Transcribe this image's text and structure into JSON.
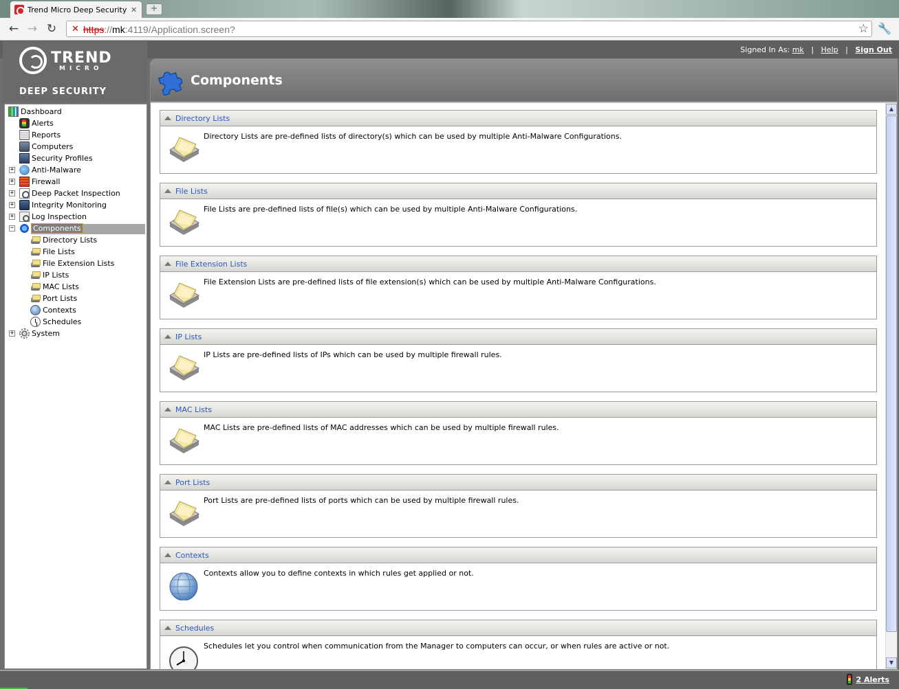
{
  "browser": {
    "tab_title": "Trend Micro Deep Security Ma",
    "url_scheme": "https",
    "url_host": "mk",
    "url_rest": ":4119/Application.screen?"
  },
  "header": {
    "signed_in_label": "Signed In As:",
    "username": "mk",
    "help": "Help",
    "sign_out": "Sign Out",
    "separator": "|"
  },
  "brand": {
    "name": "TREND",
    "sub": "MICRO",
    "product": "DEEP SECURITY"
  },
  "nav": {
    "items": [
      {
        "label": "Dashboard",
        "icon": "dashboard-icon"
      },
      {
        "label": "Alerts",
        "icon": "alerts-icon"
      },
      {
        "label": "Reports",
        "icon": "reports-icon"
      },
      {
        "label": "Computers",
        "icon": "computers-icon"
      },
      {
        "label": "Security Profiles",
        "icon": "security-profiles-icon"
      },
      {
        "label": "Anti-Malware",
        "icon": "anti-malware-icon"
      },
      {
        "label": "Firewall",
        "icon": "firewall-icon"
      },
      {
        "label": "Deep Packet Inspection",
        "icon": "dpi-icon"
      },
      {
        "label": "Integrity Monitoring",
        "icon": "integrity-monitoring-icon"
      },
      {
        "label": "Log Inspection",
        "icon": "log-inspection-icon"
      },
      {
        "label": "Components",
        "icon": "components-icon"
      },
      {
        "label": "Directory Lists",
        "icon": "list-icon"
      },
      {
        "label": "File Lists",
        "icon": "list-icon"
      },
      {
        "label": "File Extension Lists",
        "icon": "list-icon"
      },
      {
        "label": "IP Lists",
        "icon": "list-icon"
      },
      {
        "label": "MAC Lists",
        "icon": "list-icon"
      },
      {
        "label": "Port Lists",
        "icon": "list-icon"
      },
      {
        "label": "Contexts",
        "icon": "contexts-icon"
      },
      {
        "label": "Schedules",
        "icon": "schedules-icon"
      },
      {
        "label": "System",
        "icon": "system-icon"
      }
    ],
    "selected": "Components"
  },
  "main": {
    "title": "Components",
    "sections": [
      {
        "title": "Directory Lists",
        "desc": "Directory Lists are pre-defined lists of directory(s) which can be used by multiple Anti-Malware Configurations.",
        "icon": "list-icon"
      },
      {
        "title": "File Lists",
        "desc": "File Lists are pre-defined lists of file(s) which can be used by multiple Anti-Malware Configurations.",
        "icon": "list-icon"
      },
      {
        "title": "File Extension Lists",
        "desc": "File Extension Lists are pre-defined lists of file extension(s) which can be used by multiple Anti-Malware Configurations.",
        "icon": "list-icon"
      },
      {
        "title": "IP Lists",
        "desc": "IP Lists are pre-defined lists of IPs which can be used by multiple firewall rules.",
        "icon": "list-icon"
      },
      {
        "title": "MAC Lists",
        "desc": "MAC Lists are pre-defined lists of MAC addresses which can be used by multiple firewall rules.",
        "icon": "list-icon"
      },
      {
        "title": "Port Lists",
        "desc": "Port Lists are pre-defined lists of ports which can be used by multiple firewall rules.",
        "icon": "list-icon"
      },
      {
        "title": "Contexts",
        "desc": "Contexts allow you to define contexts in which rules get applied or not.",
        "icon": "contexts-icon"
      },
      {
        "title": "Schedules",
        "desc": "Schedules let you control when communication from the Manager to computers can occur, or when rules are active or not.",
        "icon": "schedules-icon"
      }
    ]
  },
  "status": {
    "alerts": "2 Alerts"
  },
  "colors": {
    "link_blue": "#2a56c6",
    "chrome_gray": "#5f5f5f",
    "selected_gray": "#7d7d7d"
  }
}
